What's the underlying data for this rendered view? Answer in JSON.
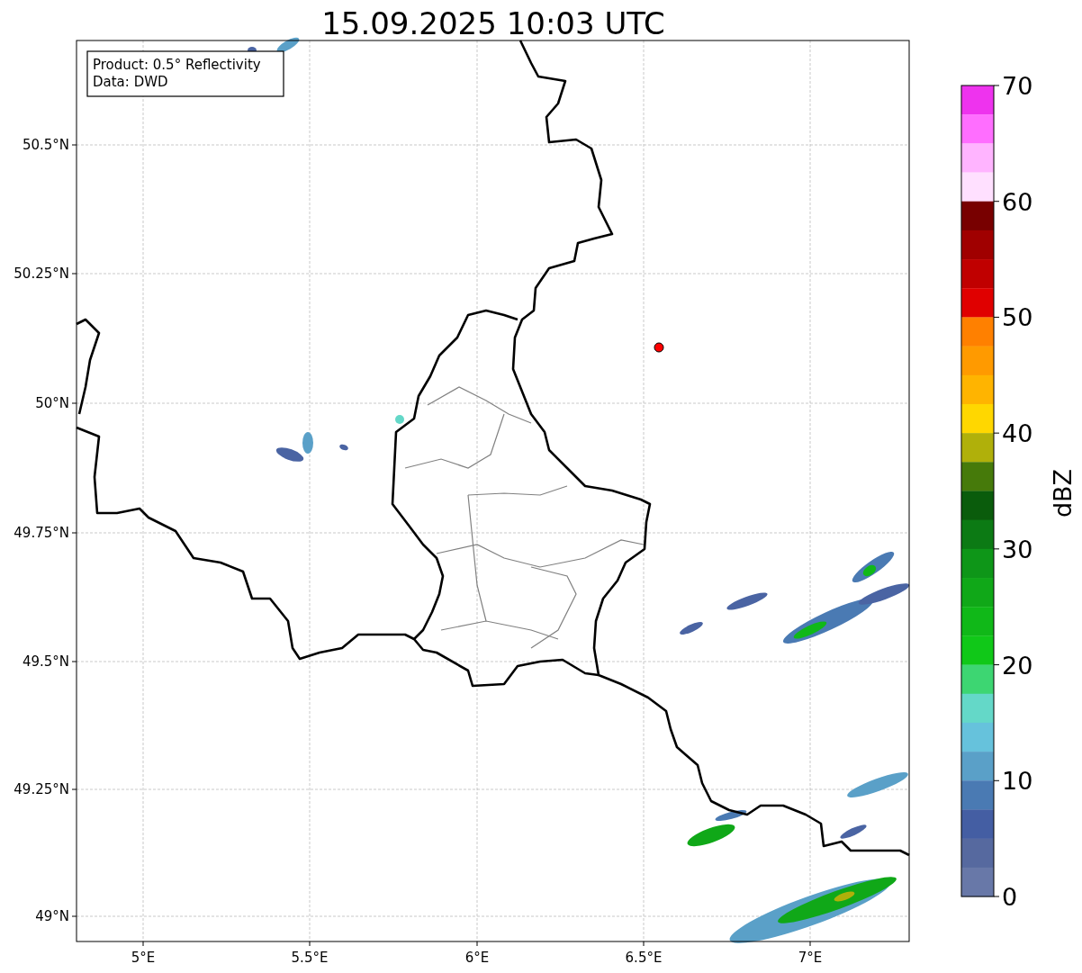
{
  "title": "15.09.2025 10:03 UTC",
  "info_box": [
    "Product: 0.5° Reflectivity",
    "Data: DWD"
  ],
  "x_ticks": [
    "5°E",
    "5.5°E",
    "6°E",
    "6.5°E",
    "7°E"
  ],
  "y_ticks": [
    "50.5°N",
    "50.25°N",
    "50°N",
    "49.75°N",
    "49.5°N",
    "49.25°N",
    "49°N"
  ],
  "colorbar": {
    "label": "dBZ",
    "ticks": [
      "70",
      "60",
      "50",
      "40",
      "30",
      "20",
      "10",
      "0"
    ],
    "bins": [
      {
        "color": "#ee33ee"
      },
      {
        "color": "#ff6eff"
      },
      {
        "color": "#ffb4ff"
      },
      {
        "color": "#ffe0ff"
      },
      {
        "color": "#780000"
      },
      {
        "color": "#a00000"
      },
      {
        "color": "#c00000"
      },
      {
        "color": "#e00000"
      },
      {
        "color": "#ff8000"
      },
      {
        "color": "#ff9a00"
      },
      {
        "color": "#ffb400"
      },
      {
        "color": "#ffd700"
      },
      {
        "color": "#b0b00a"
      },
      {
        "color": "#467a0a"
      },
      {
        "color": "#0a5c0c"
      },
      {
        "color": "#0c7a14"
      },
      {
        "color": "#0e9618"
      },
      {
        "color": "#10a818"
      },
      {
        "color": "#10b818"
      },
      {
        "color": "#10c818"
      },
      {
        "color": "#3dd672"
      },
      {
        "color": "#64d8c8"
      },
      {
        "color": "#66c2dc"
      },
      {
        "color": "#5aa0c8"
      },
      {
        "color": "#4a7ab3"
      },
      {
        "color": "#445ea3"
      },
      {
        "color": "#56699f"
      },
      {
        "color": "#6878a8"
      }
    ]
  }
}
